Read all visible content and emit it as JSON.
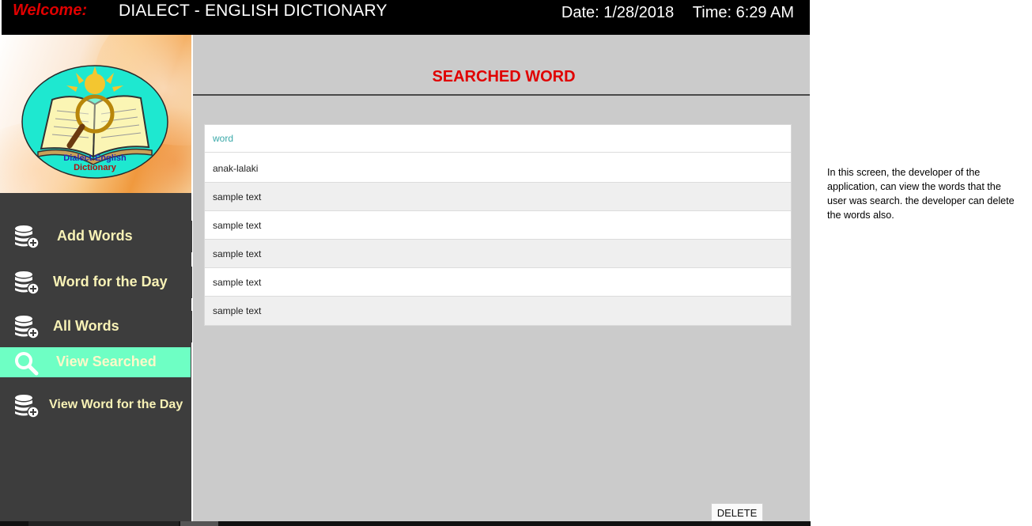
{
  "header": {
    "welcome": "Welcome:",
    "title": "DIALECT - ENGLISH DICTIONARY",
    "date": "Date: 1/28/2018",
    "time": "Time: 6:29 AM"
  },
  "logo": {
    "line1": "Dialect-English",
    "line2": "Dictionary",
    "icon": "open-book-magnifier-sun-logo"
  },
  "sidebar": {
    "items": [
      {
        "label": "Add Words",
        "icon": "database-add-icon",
        "active": false
      },
      {
        "label": "Word for the Day",
        "icon": "database-add-icon",
        "active": false
      },
      {
        "label": "All Words",
        "icon": "database-add-icon",
        "active": false
      },
      {
        "label": "View Searched",
        "icon": "search-icon",
        "active": true
      },
      {
        "label": "View Word for the Day",
        "icon": "database-add-icon",
        "active": false
      }
    ]
  },
  "main": {
    "title": "SEARCHED WORD",
    "table": {
      "header": "word",
      "rows": [
        "anak-lalaki",
        "sample text",
        "sample text",
        "sample text",
        "sample text",
        "sample text"
      ]
    },
    "delete_label": "DELETE"
  },
  "note": "In this screen, the developer of the application, can view the words that the user was search. the developer can delete the words also.",
  "colors": {
    "header_bg": "#000000",
    "welcome": "#e00000",
    "title_red": "#e00000",
    "sidebar_bg": "#3d3d3d",
    "nav_text": "#f8f2b6",
    "active_bg": "#6effc4",
    "main_bg": "#cbcbcb",
    "table_header_text": "#3aa9a9"
  }
}
